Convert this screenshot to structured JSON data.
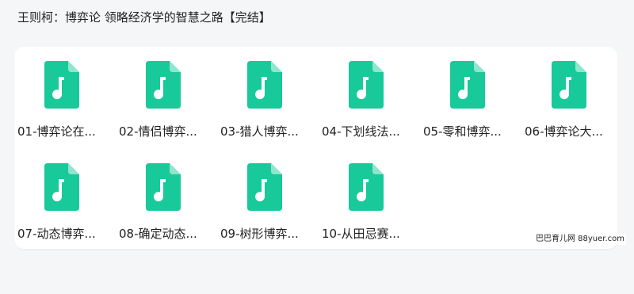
{
  "header": {
    "title": "王则柯：博弈论 领略经济学的智慧之路【完结】"
  },
  "icon": {
    "name": "audio-file-icon",
    "color": "#18c99a"
  },
  "files": [
    {
      "label": "01-博弈论在..."
    },
    {
      "label": "02-情侣博弈..."
    },
    {
      "label": "03-猎人博弈..."
    },
    {
      "label": "04-下划线法..."
    },
    {
      "label": "05-零和博弈..."
    },
    {
      "label": "06-博弈论大..."
    },
    {
      "label": "07-动态博弈..."
    },
    {
      "label": "08-确定动态..."
    },
    {
      "label": "09-树形博弈..."
    },
    {
      "label": "10-从田忌赛..."
    }
  ],
  "watermark": {
    "text": "巴巴育儿网 88yuer.com"
  }
}
